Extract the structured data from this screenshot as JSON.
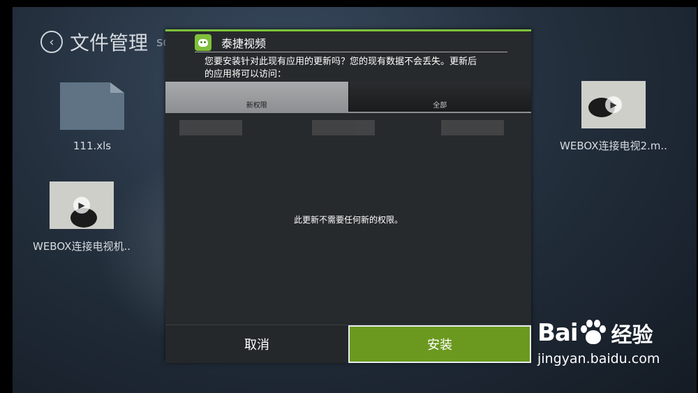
{
  "app": {
    "back_glyph": "‹",
    "title": "文件管理",
    "subtitle": "sdcard"
  },
  "files": [
    {
      "name": "111.xls",
      "kind": "document"
    },
    {
      "name": "WEBOX连接电视2.m..",
      "kind": "video"
    },
    {
      "name": "WEBOX连接电视机..",
      "kind": "video"
    }
  ],
  "dialog": {
    "title": "泰捷视频",
    "message": "您要安装针对此现有应用的更新吗？您的现有数据不会丢失。更新后的应用将可以访问：",
    "tabs": [
      {
        "label": "新权限",
        "active": true
      },
      {
        "label": "全部",
        "active": false
      }
    ],
    "empty_message": "此更新不需要任何新的权限。",
    "cancel_label": "取消",
    "install_label": "安装",
    "accent_color": "#7fc13a",
    "install_color": "#6b991f"
  },
  "watermark": {
    "brand": "Bai",
    "brand_suffix": "经验",
    "url": "jingyan.baidu.com"
  }
}
